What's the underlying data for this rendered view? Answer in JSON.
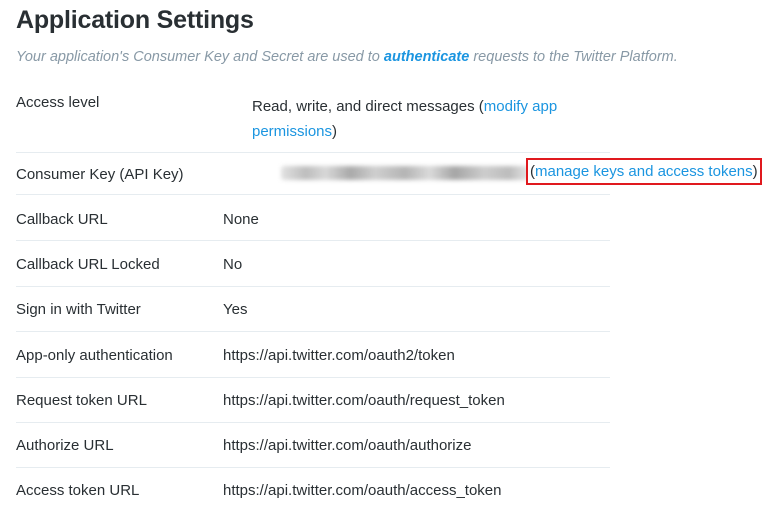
{
  "header": {
    "title": "Application Settings",
    "subtitle_before": "Your application's Consumer Key and Secret are used to ",
    "subtitle_link": "authenticate",
    "subtitle_after": " requests to the Twitter Platform."
  },
  "access_level": {
    "label": "Access level",
    "value": "Read, write, and direct messages (",
    "link_line1": "modify app",
    "link_line2": "permissions",
    "close_paren": ")"
  },
  "consumer_key": {
    "label": "Consumer Key (API Key)",
    "manage_open": "(",
    "manage_link": "manage keys and access tokens",
    "manage_close": ")"
  },
  "rows": [
    {
      "label": "Callback URL",
      "value": "None"
    },
    {
      "label": "Callback URL Locked",
      "value": "No"
    },
    {
      "label": "Sign in with Twitter",
      "value": "Yes"
    },
    {
      "label": "App-only authentication",
      "value": "https://api.twitter.com/oauth2/token"
    },
    {
      "label": "Request token URL",
      "value": "https://api.twitter.com/oauth/request_token"
    },
    {
      "label": "Authorize URL",
      "value": "https://api.twitter.com/oauth/authorize"
    },
    {
      "label": "Access token URL",
      "value": "https://api.twitter.com/oauth/access_token"
    }
  ],
  "colors": {
    "link": "#1b95e0",
    "highlight_border": "#e0191e",
    "subtitle": "#8899a6",
    "text": "#292f33"
  }
}
